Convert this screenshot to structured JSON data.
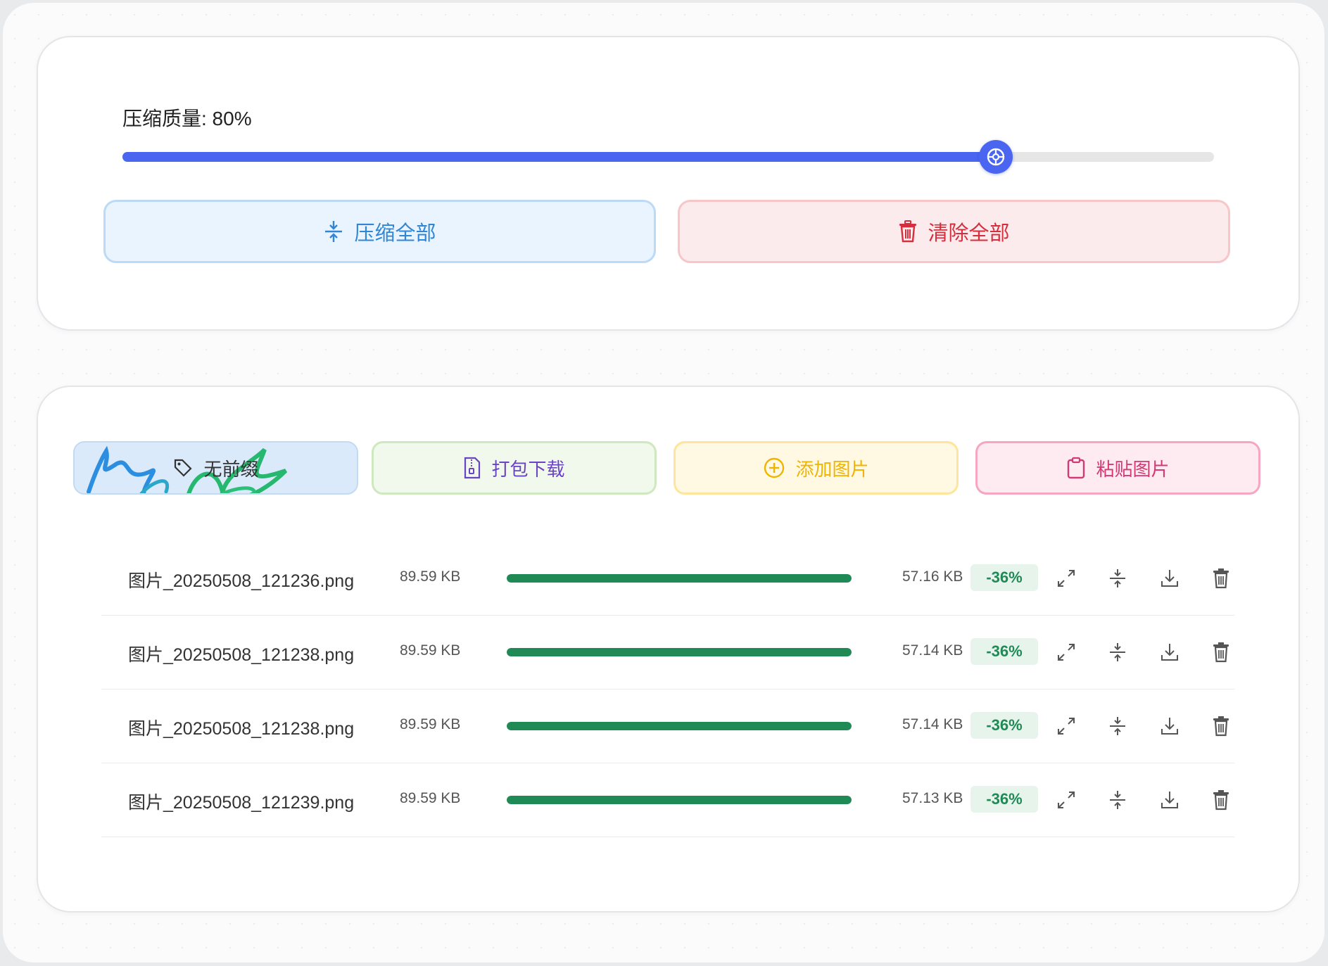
{
  "settings": {
    "quality_label": "压缩质量: 80%",
    "quality_value": 80,
    "compress_all_label": "压缩全部",
    "clear_all_label": "清除全部"
  },
  "toolbar": {
    "no_thumbnail_label": "无前缀",
    "pack_download_label": "打包下载",
    "add_images_label": "添加图片",
    "paste_images_label": "粘贴图片"
  },
  "files": [
    {
      "name": "图片_20250508_121236.png",
      "original_size": "89.59 KB",
      "progress": 1.0,
      "compressed_size": "57.16 KB",
      "reduction": "-36%"
    },
    {
      "name": "图片_20250508_121238.png",
      "original_size": "89.59 KB",
      "progress": 1.0,
      "compressed_size": "57.14 KB",
      "reduction": "-36%"
    },
    {
      "name": "图片_20250508_121238.png",
      "original_size": "89.59 KB",
      "progress": 1.0,
      "compressed_size": "57.14 KB",
      "reduction": "-36%"
    },
    {
      "name": "图片_20250508_121239.png",
      "original_size": "89.59 KB",
      "progress": 1.0,
      "compressed_size": "57.13 KB",
      "reduction": "-36%"
    }
  ],
  "icons": {
    "compress_all": "compress-icon",
    "clear_all": "trash-icon",
    "no_thumbnail": "tag-icon",
    "pack_download": "zip-file-icon",
    "add_images": "plus-circle-icon",
    "paste_images": "clipboard-icon",
    "row_actions": [
      "expand-icon",
      "compress-icon",
      "download-icon",
      "trash-icon"
    ]
  },
  "colors": {
    "accent": "#4a66f0",
    "success": "#1f8a55",
    "danger": "#d62e3d",
    "info": "#2f86d6",
    "warning": "#f0b400",
    "purple": "#6a45c2",
    "pink": "#d33a73"
  }
}
